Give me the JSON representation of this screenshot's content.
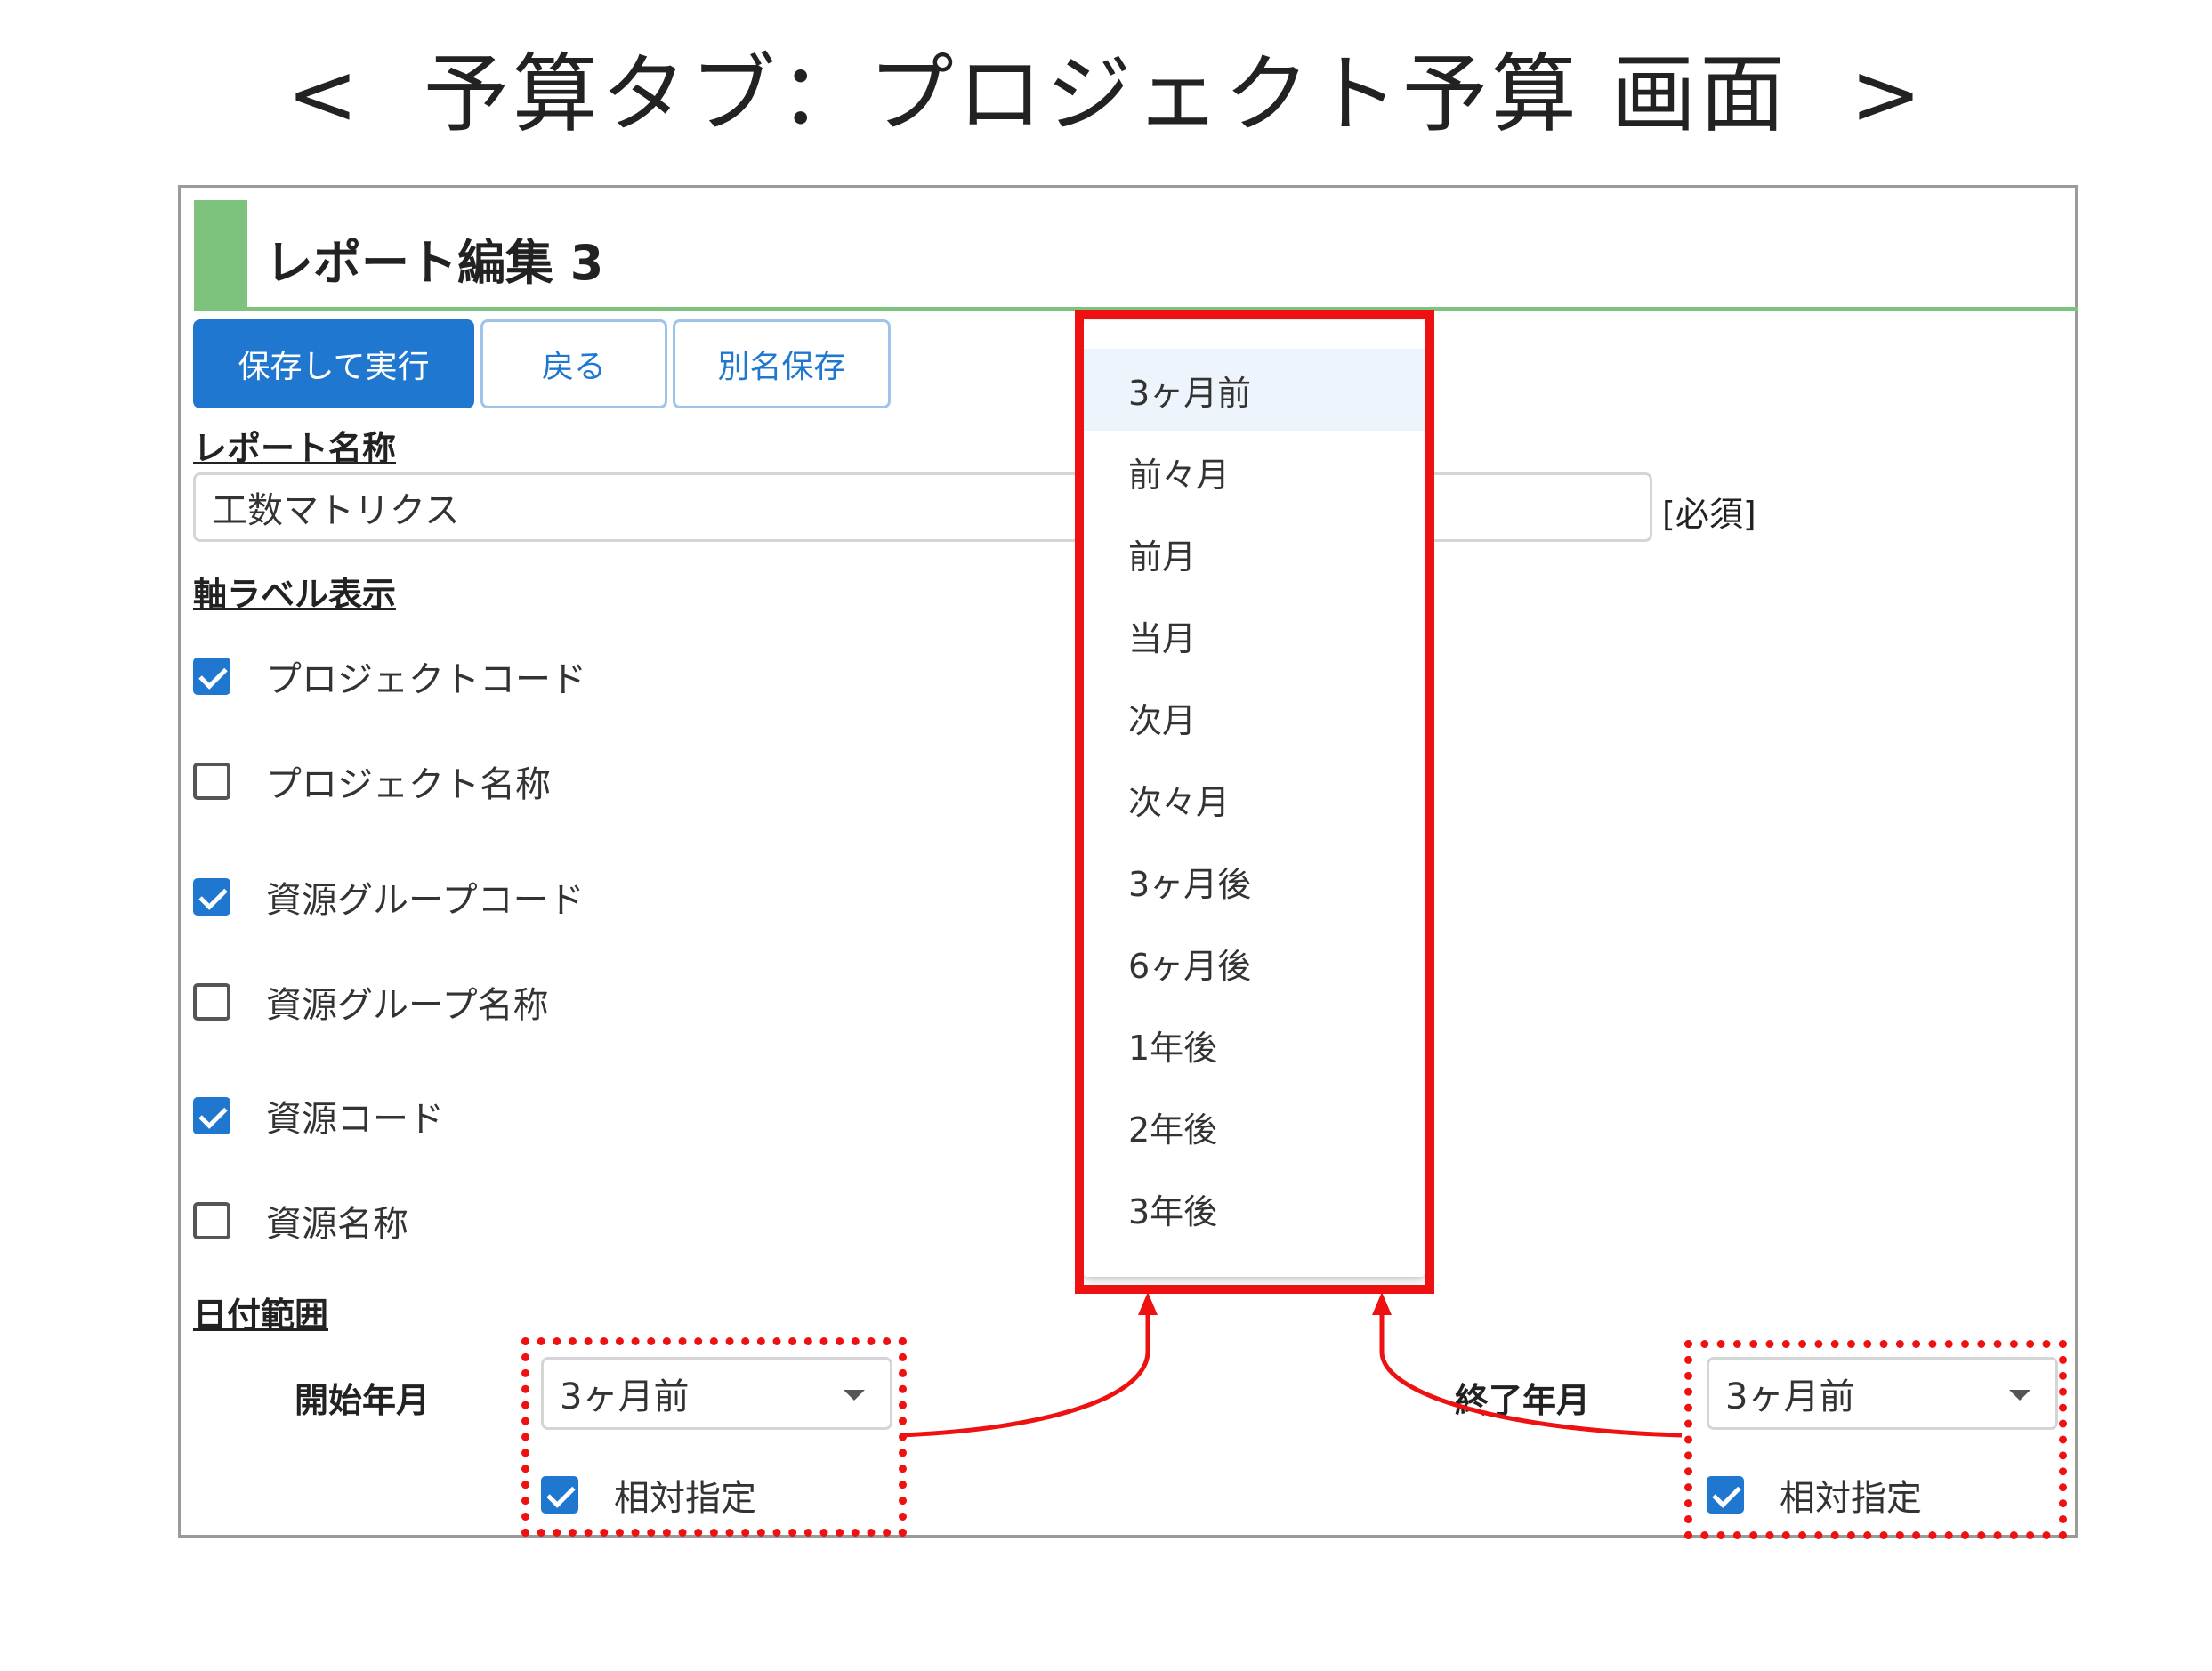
{
  "slide_title": {
    "open": "<",
    "text": "予算タブ：プロジェクト予算 画面",
    "close": ">"
  },
  "header": {
    "title": "レポート編集 3"
  },
  "toolbar": {
    "save_run_label": "保存して実行",
    "back_label": "戻る",
    "save_as_label": "別名保存"
  },
  "report_name": {
    "label": "レポート名称",
    "value": "工数マトリクス",
    "required": "[必須]"
  },
  "axis_labels": {
    "label": "軸ラベル表示",
    "items": [
      {
        "label": "プロジェクトコード",
        "checked": true
      },
      {
        "label": "プロジェクト名称",
        "checked": false
      },
      {
        "label": "資源グループコード",
        "checked": true
      },
      {
        "label": "資源グループ名称",
        "checked": false
      },
      {
        "label": "資源コード",
        "checked": true
      },
      {
        "label": "資源名称",
        "checked": false
      }
    ]
  },
  "date_range": {
    "label": "日付範囲",
    "start": {
      "label": "開始年月",
      "value": "3ヶ月前",
      "relative_label": "相対指定",
      "relative_checked": true
    },
    "end": {
      "label": "終了年月",
      "value": "3ヶ月前",
      "relative_label": "相対指定",
      "relative_checked": true
    }
  },
  "dropdown": {
    "selected_index": 0,
    "options": [
      "3ヶ月前",
      "前々月",
      "前月",
      "当月",
      "次月",
      "次々月",
      "3ヶ月後",
      "6ヶ月後",
      "1年後",
      "2年後",
      "3年後"
    ]
  },
  "colors": {
    "accent_green": "#7dc27d",
    "primary_blue": "#1f77cf",
    "highlight_red": "#ee1111"
  }
}
